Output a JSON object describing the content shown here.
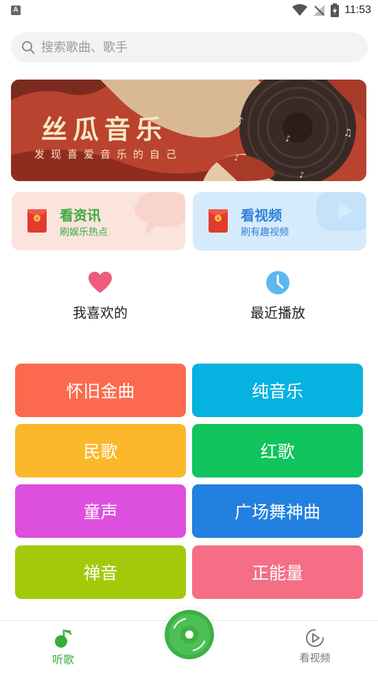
{
  "status_bar": {
    "time": "11:53",
    "indicator": "A"
  },
  "search": {
    "placeholder": "搜索歌曲、歌手"
  },
  "banner": {
    "title": "丝瓜音乐",
    "subtitle": "发现喜爱音乐的自己"
  },
  "promos": [
    {
      "title": "看资讯",
      "subtitle": "刷娱乐热点"
    },
    {
      "title": "看视频",
      "subtitle": "刷有趣视频"
    }
  ],
  "quick_actions": [
    {
      "label": "我喜欢的",
      "icon": "heart-icon"
    },
    {
      "label": "最近播放",
      "icon": "clock-icon"
    }
  ],
  "categories": [
    {
      "label": "怀旧金曲",
      "color": "#fb6a4e"
    },
    {
      "label": "纯音乐",
      "color": "#06b3e0"
    },
    {
      "label": "民歌",
      "color": "#fbb82b"
    },
    {
      "label": "红歌",
      "color": "#10c45e"
    },
    {
      "label": "童声",
      "color": "#dd4fdf"
    },
    {
      "label": "广场舞神曲",
      "color": "#2280e0"
    },
    {
      "label": "禅音",
      "color": "#a3c90a"
    },
    {
      "label": "正能量",
      "color": "#f46e86"
    }
  ],
  "bottom_nav": {
    "listen_label": "听歌",
    "video_label": "看视频",
    "active_color": "#3aab3e"
  }
}
